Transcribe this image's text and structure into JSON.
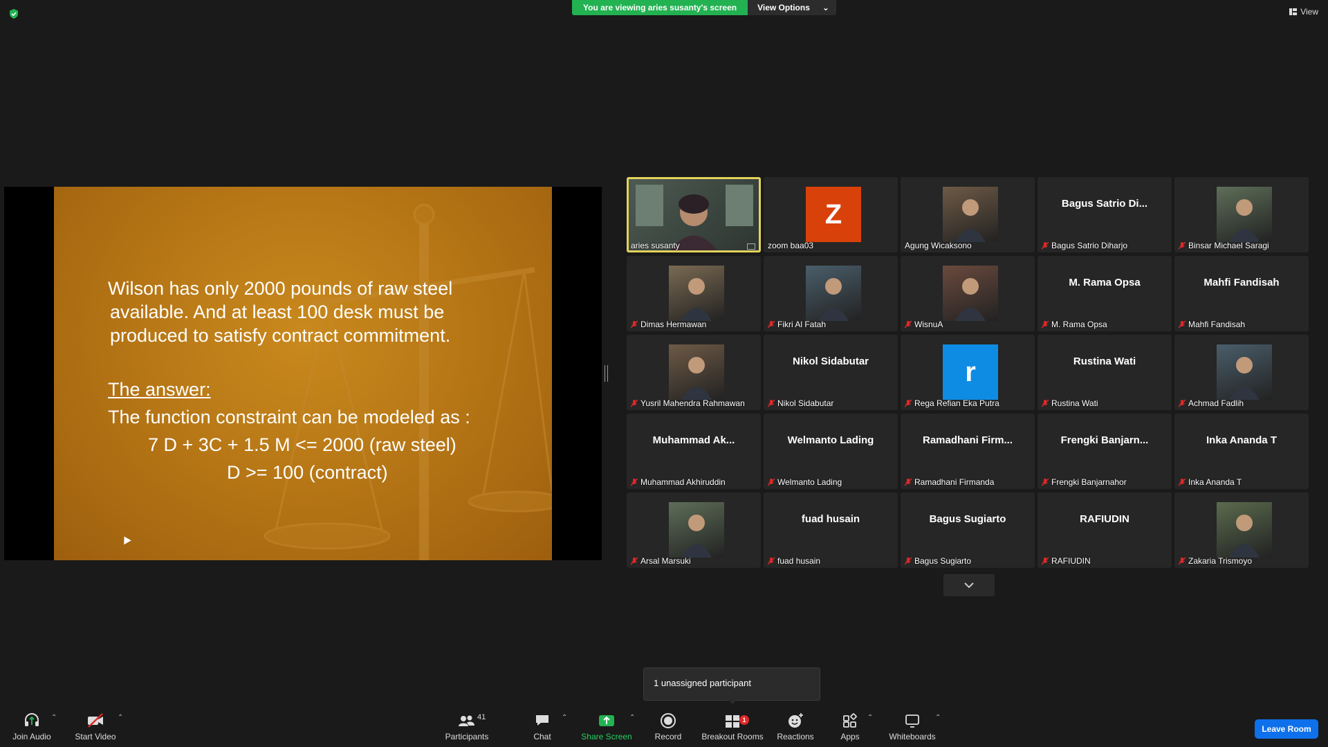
{
  "banner": {
    "viewing_text": "You are viewing aries susanty's screen",
    "view_options": "View Options"
  },
  "view_button": "View",
  "slide": {
    "lines": [
      "Wilson has only 2000 pounds of raw steel",
      "available. And at least 100 desk must be",
      "produced to satisfy contract commitment."
    ],
    "answer_heading": "The answer:",
    "answer_intro": "The function constraint can be modeled as :",
    "constraint_1": "7 D + 3C + 1.5 M <= 2000 (raw steel)",
    "constraint_2": "D >= 100 (contract)"
  },
  "participants": [
    {
      "name": "aries susanty",
      "tile": "video",
      "active": true,
      "muted": false
    },
    {
      "name": "zoom baa03",
      "tile": "letter",
      "letter": "Z",
      "letter_color": "#d9410a",
      "muted": false
    },
    {
      "name": "Agung Wicaksono",
      "tile": "photo",
      "muted": false
    },
    {
      "name": "Bagus Satrio Diharjo",
      "tile": "name",
      "display": "Bagus  Satrio  Di...",
      "muted": true
    },
    {
      "name": "Binsar Michael Saragi",
      "tile": "photo",
      "muted": true
    },
    {
      "name": "Dimas Hermawan",
      "tile": "photo",
      "muted": true
    },
    {
      "name": "Fikri Al Fatah",
      "tile": "photo",
      "muted": true
    },
    {
      "name": "WisnuA",
      "tile": "photo",
      "muted": true
    },
    {
      "name": "M. Rama Opsa",
      "tile": "name",
      "display": "M. Rama Opsa",
      "muted": true
    },
    {
      "name": "Mahfi Fandisah",
      "tile": "name",
      "display": "Mahfi Fandisah",
      "muted": true
    },
    {
      "name": "Yusril Mahendra Rahmawan",
      "tile": "photo",
      "muted": true
    },
    {
      "name": "Nikol Sidabutar",
      "tile": "name",
      "display": "Nikol Sidabutar",
      "muted": true
    },
    {
      "name": "Rega Refian Eka Putra",
      "tile": "letter",
      "letter": "r",
      "letter_color": "#0e8ce4",
      "muted": true
    },
    {
      "name": "Rustina Wati",
      "tile": "name",
      "display": "Rustina Wati",
      "muted": true
    },
    {
      "name": "Achmad Fadlih",
      "tile": "photo",
      "muted": true
    },
    {
      "name": "Muhammad Akhiruddin",
      "tile": "name",
      "display": "Muhammad  Ak...",
      "muted": true
    },
    {
      "name": "Welmanto Lading",
      "tile": "name",
      "display": "Welmanto Lading",
      "muted": true
    },
    {
      "name": "Ramadhani Firmanda",
      "tile": "name",
      "display": "Ramadhani  Firm...",
      "muted": true
    },
    {
      "name": "Frengki Banjarnahor",
      "tile": "name",
      "display": "Frengki  Banjarn...",
      "muted": true
    },
    {
      "name": "Inka Ananda T",
      "tile": "name",
      "display": "Inka Ananda T",
      "muted": true
    },
    {
      "name": "Arsal Marsuki",
      "tile": "photo",
      "muted": true
    },
    {
      "name": "fuad husain",
      "tile": "name",
      "display": "fuad husain",
      "muted": true
    },
    {
      "name": "Bagus Sugiarto",
      "tile": "name",
      "display": "Bagus Sugiarto",
      "muted": true
    },
    {
      "name": "RAFIUDIN",
      "tile": "name",
      "display": "RAFIUDIN",
      "muted": true
    },
    {
      "name": "Zakaria Trismoyo",
      "tile": "photo",
      "muted": true
    }
  ],
  "toast": "1 unassigned participant",
  "toolbar": {
    "join_audio": "Join Audio",
    "start_video": "Start Video",
    "participants": "Participants",
    "participants_count": "41",
    "chat": "Chat",
    "share_screen": "Share Screen",
    "record": "Record",
    "breakout_rooms": "Breakout Rooms",
    "breakout_badge": "1",
    "reactions": "Reactions",
    "apps": "Apps",
    "whiteboards": "Whiteboards",
    "leave_room": "Leave Room"
  },
  "colors": {
    "share_green": "#23b252",
    "active_speaker": "#e3d35c",
    "leave_blue": "#0e71eb",
    "muted_red": "#e02828"
  }
}
